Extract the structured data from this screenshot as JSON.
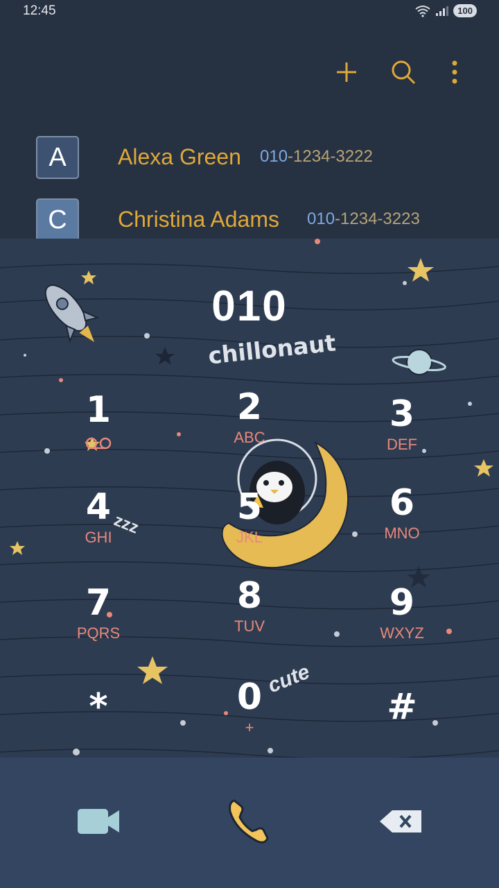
{
  "status_bar": {
    "time": "12:45",
    "battery": "100"
  },
  "contacts": [
    {
      "initial": "A",
      "name": "Alexa Green",
      "number_match": "010",
      "number_rest": "-1234-3222"
    },
    {
      "initial": "C",
      "name": "Christina Adams",
      "number_match": "010",
      "number_rest": "-1234-3223"
    }
  ],
  "dialpad": {
    "display": "010",
    "brand": "chillonaut",
    "decorations": [
      "zzz",
      "cute"
    ],
    "keys": [
      {
        "digit": "1",
        "letters": ""
      },
      {
        "digit": "2",
        "letters": "ABC"
      },
      {
        "digit": "3",
        "letters": "DEF"
      },
      {
        "digit": "4",
        "letters": "GHI"
      },
      {
        "digit": "5",
        "letters": "JKL"
      },
      {
        "digit": "6",
        "letters": "MNO"
      },
      {
        "digit": "7",
        "letters": "PQRS"
      },
      {
        "digit": "8",
        "letters": "TUV"
      },
      {
        "digit": "9",
        "letters": "WXYZ"
      },
      {
        "digit": "*",
        "letters": ""
      },
      {
        "digit": "0",
        "letters": "+"
      },
      {
        "digit": "#",
        "letters": ""
      }
    ]
  },
  "colors": {
    "accent": "#e0a838",
    "match": "#7fa9e3",
    "letters": "#e8897a"
  }
}
